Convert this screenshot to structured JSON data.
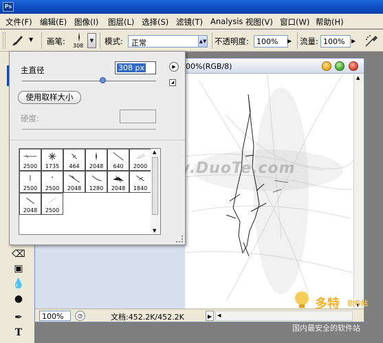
{
  "app": {
    "icon_text": "Ps"
  },
  "menu": [
    {
      "label": "文件(F)"
    },
    {
      "label": "编辑(E)"
    },
    {
      "label": "图像(I)"
    },
    {
      "label": "图层(L)"
    },
    {
      "label": "选择(S)"
    },
    {
      "label": "滤镜(T)"
    },
    {
      "label": "Analysis"
    },
    {
      "label": "视图(V)"
    },
    {
      "label": "窗口(W)"
    },
    {
      "label": "帮助(H)"
    }
  ],
  "options_bar": {
    "brush_label": "画笔:",
    "brush_size": "308",
    "mode_label": "模式:",
    "mode_value": "正常",
    "opacity_label": "不透明度:",
    "opacity_value": "100%",
    "flow_label": "流量:",
    "flow_value": "100%"
  },
  "brush_popup": {
    "master_diameter_label": "主直径",
    "master_diameter_value": "308 px",
    "master_diameter_fraction": 0.6,
    "use_sample_size_button": "使用取样大小",
    "hardness_label": "硬度:",
    "presets": [
      {
        "size": "2500"
      },
      {
        "size": "1735"
      },
      {
        "size": "464"
      },
      {
        "size": "2048"
      },
      {
        "size": "640"
      },
      {
        "size": "2000"
      },
      {
        "size": "2500"
      },
      {
        "size": "2500"
      },
      {
        "size": "2048"
      },
      {
        "size": "1280"
      },
      {
        "size": "2048"
      },
      {
        "size": "1840"
      },
      {
        "size": "2048"
      },
      {
        "size": "2500"
      }
    ]
  },
  "document": {
    "title_fragment": "00%(RGB/8)",
    "zoom": "100%",
    "doc_info": "文档:452.2K/452.2K"
  },
  "watermarks": {
    "duote": "www.DuoTe.com",
    "brand": "多特",
    "brand_suffix": "软件站",
    "brand_sub": "国内最安全的软件站"
  },
  "colors": {
    "titlebar_blue": "#0b4bc0",
    "menu_bg": "#ece9d8",
    "brand_orange": "#f0b02a"
  }
}
